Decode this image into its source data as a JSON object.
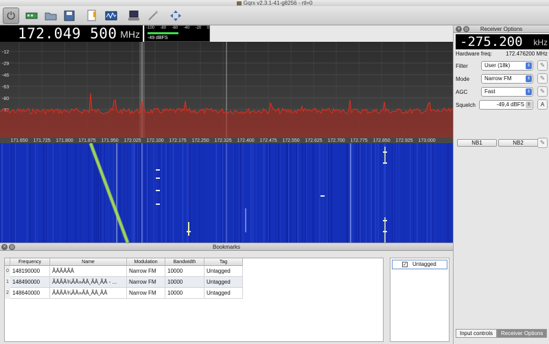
{
  "window": {
    "title": "Gqrx v2.3.1-41-g8256 - rtl=0"
  },
  "toolbar": {
    "icons": [
      "power-icon",
      "hardware-icon",
      "open-folder-icon",
      "save-icon",
      "document-edit-icon",
      "dsp-icon",
      "remote-control-icon",
      "wand-icon",
      "fit-view-icon"
    ]
  },
  "frequency": {
    "value": "172.049 500",
    "unit": "MHz"
  },
  "signal_meter": {
    "ticks": [
      "-100",
      "-80",
      "-60",
      "-40",
      "-20",
      "0"
    ],
    "level": "-49 dBFS",
    "level_fraction": 0.51
  },
  "spectrum": {
    "y_labels": [
      "-12",
      "-29",
      "-46",
      "-63",
      "-80",
      "-97"
    ],
    "x_labels": [
      "171.650",
      "171.725",
      "171.800",
      "171.875",
      "171.950",
      "172.025",
      "172.100",
      "172.175",
      "172.250",
      "172.325",
      "172.400",
      "172.475",
      "172.550",
      "172.625",
      "172.700",
      "172.775",
      "172.850",
      "172.925",
      "173.000"
    ]
  },
  "receiver": {
    "title": "Receiver Options",
    "offset_value": "-275.200",
    "offset_unit": "kHz",
    "hw_label": "Hardware freq:",
    "hw_value": "172.476200 MHz",
    "filter_label": "Filter",
    "filter_value": "User (18k)",
    "mode_label": "Mode",
    "mode_value": "Narrow FM",
    "agc_label": "AGC",
    "agc_value": "Fast",
    "squelch_label": "Squelch",
    "squelch_value": "-49,4 dBFS",
    "squelch_btn": "A",
    "nb1": "NB1",
    "nb2": "NB2",
    "tabs": [
      "Input controls",
      "Receiver Options"
    ],
    "active_tab": 1
  },
  "bookmarks": {
    "title": "Bookmarks",
    "columns": [
      "Frequency",
      "Name",
      "Modulation",
      "Bandwidth",
      "Tag"
    ],
    "rows": [
      {
        "n": "0",
        "frequency": "148190000",
        "name": "ÃÂÃÂÃÂ",
        "modulation": "Narrow FM",
        "bandwidth": "10000",
        "tag": "Untagged"
      },
      {
        "n": "1",
        "frequency": "148490000",
        "name": "ÃÂÃÂ¾ÃÂ»ÃÂ¸ÃÂ¸ÃÂ - ...",
        "modulation": "Narrow FM",
        "bandwidth": "10000",
        "tag": "Untagged"
      },
      {
        "n": "2",
        "frequency": "148640000",
        "name": "ÃÂÃÂ¾ÃÂ»ÃÂ¸ÃÂ¸ÃÂ",
        "modulation": "Narrow FM",
        "bandwidth": "10000",
        "tag": "Untagged"
      }
    ],
    "tags": [
      {
        "name": "Untagged",
        "checked": true
      }
    ]
  },
  "colors": {
    "spectrum_trace": "#e03020",
    "waterfall_bg": "#1530b8",
    "display_bg": "#000000"
  }
}
